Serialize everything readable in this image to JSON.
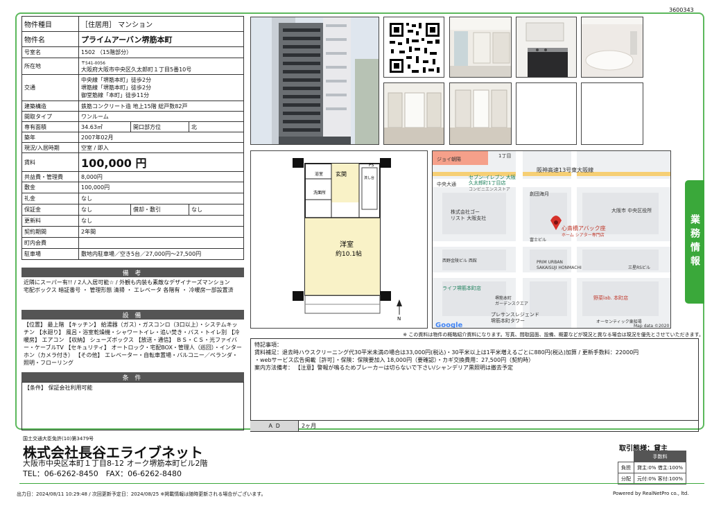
{
  "doc_id": "3600343",
  "side_tab": "業務情報",
  "info": {
    "type_label": "物件種目",
    "type_value": "［住居用］ マンション",
    "name_label": "物件名",
    "name_value": "プライムアーバン堺筋本町",
    "room_label": "号室名",
    "room_value": "1502 （15階部分）",
    "addr_label": "所在地",
    "zip": "〒541-0056",
    "addr_value": "大阪府大阪市中央区久太郎町１丁目5番10号",
    "traffic_label": "交通",
    "traffic_1": "中央線「堺筋本町」徒歩2分",
    "traffic_2": "堺筋線「堺筋本町」徒歩2分",
    "traffic_3": "御堂筋線「本町」徒歩11分",
    "structure_label": "建築構造",
    "structure_value": "鉄筋コンクリート造 地上15階 総戸数82戸",
    "layout_label": "間取タイプ",
    "layout_value": "ワンルーム",
    "area_label": "専有面積",
    "area_value": "34.63㎡",
    "dir_label": "開口部方位",
    "dir_value": "北",
    "built_label": "築年",
    "built_value": "2007年02月",
    "status_label": "現況/入居時期",
    "status_value": "空室 / 即入",
    "rent_label": "賃料",
    "rent_value": "100,000 円",
    "mgmt_label": "共益費・管理費",
    "mgmt_value": "8,000円",
    "deposit_label": "敷金",
    "deposit_value": "100,000円",
    "key_label": "礼金",
    "key_value": "なし",
    "hoshokin_label": "保証金",
    "hoshokin_value": "なし",
    "shokyaku_label": "償却・敷引",
    "shokyaku_value": "なし",
    "renewal_label": "更新料",
    "renewal_value": "なし",
    "contract_label": "契約期間",
    "contract_value": "2年間",
    "town_label": "町内会費",
    "town_value": "",
    "parking_label": "駐車場",
    "parking_value": "敷地内駐車場／空き5台／27,000円～27,500円"
  },
  "biko": {
    "title": "備 考",
    "text": "近隣にスーパー有!! / 2人入居可能☆ / 外観も内装も素敵なデザイナーズマンション\n宅配ボックス 暗証番号 ・ 管理形態 清掃 ・ エレベータ 各階有 ・ 冷暖房一部設置済"
  },
  "setsubi": {
    "title": "設 備",
    "text": "【位置】 最上階 【キッチン】 給湯器（ガス）・ガスコンロ（3口以上）・システムキッチン 【水廻り】 風呂・浴室乾燥機・シャワートイレ・追い焚き・バス・トイレ別 【冷暖房】 エアコン 【収納】 シューズボックス 【放送・通信】 ＢＳ・ＣＳ・光ファイバー・ケーブルTV 【セキュリティ】 オートロック・宅配BOX・管理人（巡回）・インターホン（カメラ付き） 【その他】 エレベーター・自転車置場・バルコニー／ベランダ・照明・フローリング"
  },
  "joken": {
    "title": "条 件",
    "text": "【条件】 保証会社利用可能"
  },
  "floor": {
    "room_name": "洋室",
    "room_size": "約10.1帖",
    "genkan": "玄関",
    "ps": "PS",
    "sink": "流し台",
    "bath": "浴室",
    "wash": "洗面所"
  },
  "map": {
    "labels": [
      "1丁目",
      "セブン-イレブン 大阪",
      "久太郎町1丁目店",
      "阪神高速13号東大阪線",
      "中央大通",
      "コンビニエンスストア",
      "創団海月",
      "株式会社ゴー",
      "リスト 大阪支社",
      "大阪市 中央区役所",
      "心斎橋アバック座",
      "ホーム シアター専門店",
      "PRIM URBAN",
      "SAKAISUJI HONMACHI",
      "三星RSビル",
      "ライフ堺筋本町店",
      "堺筋本町",
      "ガーデンスクエア",
      "野菜lab. 本町店",
      "プレサンスレジェンド",
      "堺筋本町タワー",
      "オーセンティック東船場",
      "西野金陵ビル 西館",
      "富士ビル",
      "ジョイ朝陽"
    ],
    "google": "Google",
    "copyright": "Map data ©2020"
  },
  "note": "※ この資料は物件の概略紹介資料になります。写真、間取図面、設備、概要などが現況と異なる場合は現況を優先とさせていただきます。",
  "remarks": {
    "line1": "特記事項：",
    "line2": "賃料補足：退去時ハウスクリーニング代30平米未満の場合は33,000円(税込)・30平米以上は1平米増えるごとに880円(税込)加算 / 更新手数料：22000円",
    "line3": "・webサービス広告掲載［許可］・保険：保険要加入 18,000円（要確認）・カギ交換費用：27,500円（契約時）",
    "line4": "案内方法備考： 【注意】警報が鳴るためブレーカーは切らないで下さい/シャンデリア黒照明は撤去予定",
    "ad_label": "Ａ Ｄ",
    "ad_value": "2ヶ月"
  },
  "company": {
    "license": "国土交通大臣免許(10)第3479号",
    "name": "株式会社長谷エライブネット",
    "address": "大阪市中央区本町１丁目8-12 オーク堺筋本町ビル2階",
    "tel": "TEL：06-6262-8450　FAX：06-6262-8480"
  },
  "torihiki": "取引態様：貸主",
  "fee": {
    "header": "手数料",
    "r1_label": "負担",
    "r1_value": "貸主:0% 借主:100%",
    "r2_label": "分配",
    "r2_value": "元付:0% 客付:100%"
  },
  "footer_left": "出力日：2024/08/11 10:29:48 / 次回更新予定日：2024/08/25 ※掲載情報は随時更新される場合がございます。",
  "footer_right": "Powered by RealNetPro co., ltd."
}
